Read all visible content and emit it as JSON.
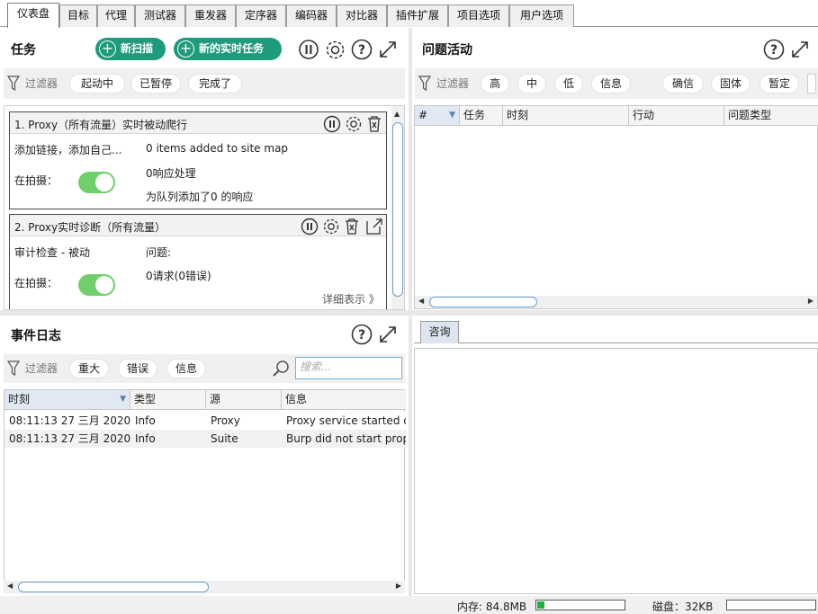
{
  "tabs": [
    "仪表盘",
    "目标",
    "代理",
    "测试器",
    "重发器",
    "定序器",
    "编码器",
    "对比器",
    "插件扩展",
    "项目选项",
    "用户选项"
  ],
  "tasks": {
    "title": "任务",
    "new_scan": "新扫描",
    "new_live_task": "新的实时任务",
    "filter_label": "过滤器",
    "filters": [
      "起动中",
      "已暂停",
      "完成了"
    ],
    "items": [
      {
        "title": "1. Proxy（所有流量）实时被动爬行",
        "left_text": "添加链接，添加自己...",
        "right_lines": [
          "0 items added to site map",
          "0响应处理",
          "为队列添加了0 的响应"
        ],
        "capture_label": "在拍摄："
      },
      {
        "title": "2. Proxy实时诊断（所有流量）",
        "left_text": "审计检查 - 被动",
        "right_lines": [
          "问题:",
          "0请求(0错误)"
        ],
        "capture_label": "在拍摄：",
        "details_link": "详细表示 》"
      }
    ]
  },
  "issues": {
    "title": "问题活动",
    "filter_label": "过滤器",
    "severity_filters": [
      "高",
      "中",
      "低",
      "信息"
    ],
    "confidence_filters": [
      "确信",
      "固体",
      "暂定"
    ],
    "columns": [
      "#",
      "任务",
      "时刻",
      "行动",
      "问题类型"
    ]
  },
  "event_log": {
    "title": "事件日志",
    "filter_label": "过滤器",
    "filters": [
      "重大",
      "错误",
      "信息"
    ],
    "search_placeholder": "搜索...",
    "columns": [
      "时刻",
      "类型",
      "源",
      "信息"
    ],
    "rows": [
      [
        "08:11:13 27 三月 2020",
        "Info",
        "Proxy",
        "Proxy service started o"
      ],
      [
        "08:11:13 27 三月 2020",
        "Info",
        "Suite",
        "Burp did not start prope"
      ]
    ]
  },
  "advisory": {
    "tab": "咨询"
  },
  "status": {
    "memory_label": "内存: 84.8MB",
    "memory_fraction": 0.08,
    "disk_label": "磁盘：32KB",
    "disk_fraction": 0.0
  },
  "colors": {
    "accent_green": "#1e9a7c",
    "toggle_green": "#6fcf6a",
    "scroll_blue": "#6a9dd1"
  }
}
